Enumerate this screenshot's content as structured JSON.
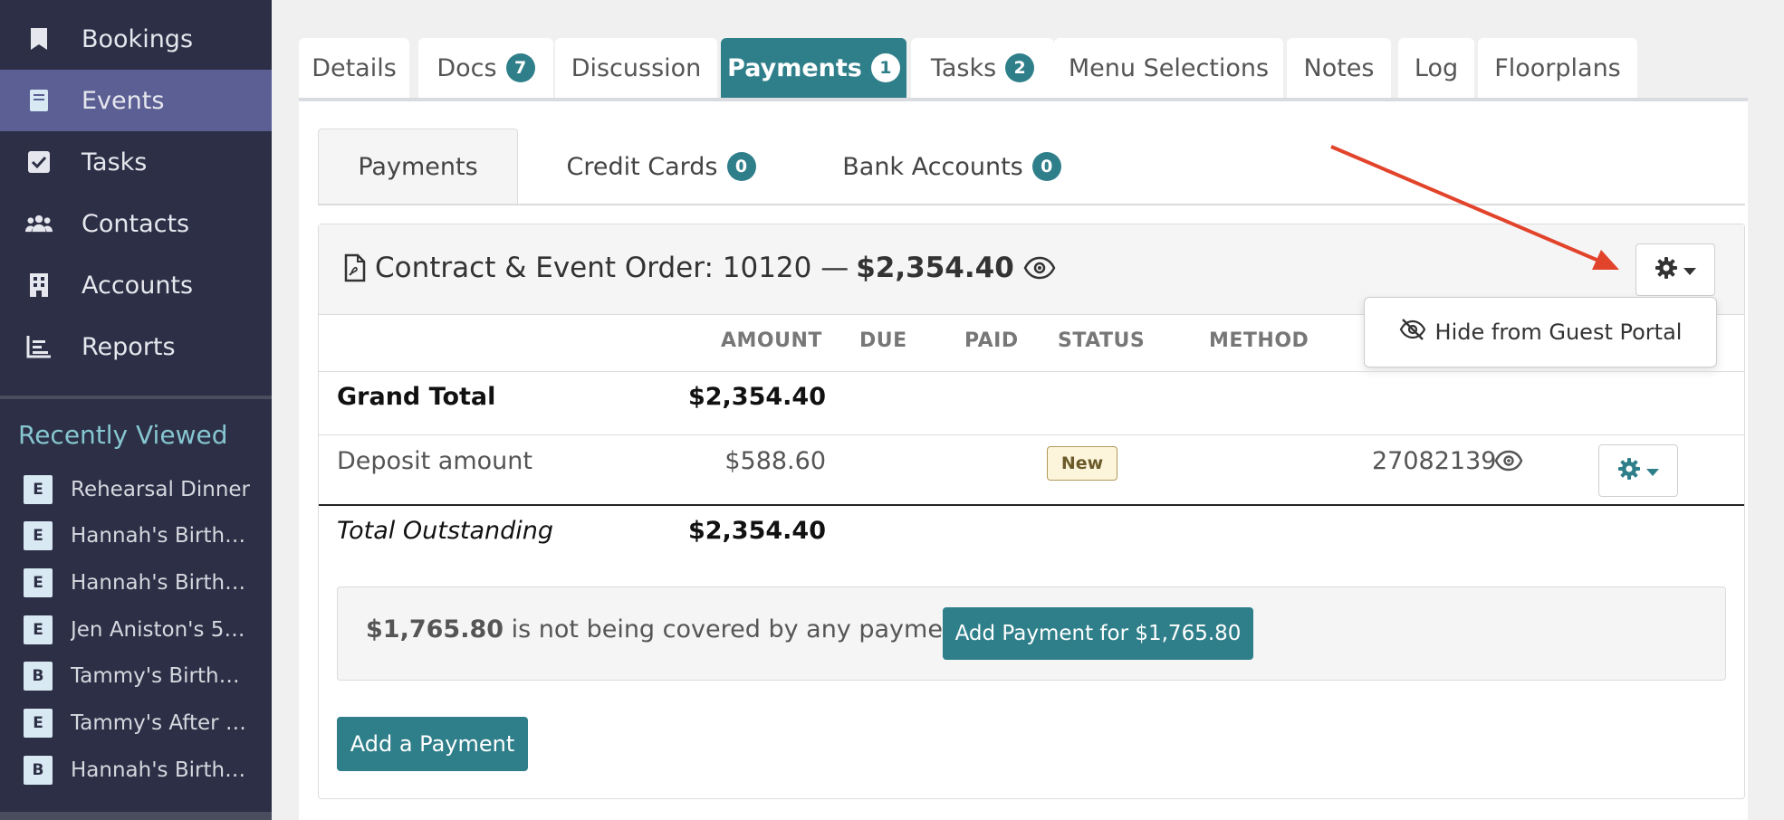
{
  "sidebar": {
    "nav": [
      {
        "label": "Bookings",
        "icon": "bookmark-icon"
      },
      {
        "label": "Events",
        "icon": "calendar-book-icon",
        "active": true
      },
      {
        "label": "Tasks",
        "icon": "checkbox-icon"
      },
      {
        "label": "Contacts",
        "icon": "users-icon"
      },
      {
        "label": "Accounts",
        "icon": "building-icon"
      },
      {
        "label": "Reports",
        "icon": "chart-icon"
      }
    ],
    "recently_viewed_title": "Recently Viewed",
    "recently_viewed": [
      {
        "badge": "E",
        "label": "Rehearsal Dinner"
      },
      {
        "badge": "E",
        "label": "Hannah's Birthd..."
      },
      {
        "badge": "E",
        "label": "Hannah's Birthd..."
      },
      {
        "badge": "E",
        "label": "Jen Aniston's 55..."
      },
      {
        "badge": "B",
        "label": "Tammy's Birthd..."
      },
      {
        "badge": "E",
        "label": "Tammy's After P..."
      },
      {
        "badge": "B",
        "label": "Hannah's Birthd..."
      }
    ]
  },
  "tabs": [
    {
      "label": "Details"
    },
    {
      "label": "Docs",
      "badge": "7"
    },
    {
      "label": "Discussion"
    },
    {
      "label": "Payments",
      "badge": "1",
      "active": true
    },
    {
      "label": "Tasks",
      "badge": "2"
    },
    {
      "label": "Menu Selections"
    },
    {
      "label": "Notes"
    },
    {
      "label": "Log"
    },
    {
      "label": "Floorplans"
    }
  ],
  "subtabs": [
    {
      "label": "Payments",
      "active": true
    },
    {
      "label": "Credit Cards",
      "badge": "0"
    },
    {
      "label": "Bank Accounts",
      "badge": "0"
    }
  ],
  "card": {
    "title": "Contract & Event Order: 10120 —",
    "title_amount": "$2,354.40",
    "dropdown_item": "Hide from Guest Portal",
    "columns": {
      "amount": "AMOUNT",
      "due": "DUE",
      "paid": "PAID",
      "status": "STATUS",
      "method": "METHOD"
    },
    "grand_total": {
      "label": "Grand Total",
      "amount": "$2,354.40"
    },
    "deposit": {
      "label": "Deposit amount",
      "amount": "$588.60",
      "status": "New",
      "reference": "27082139"
    },
    "total_outstanding": {
      "label": "Total Outstanding",
      "amount": "$2,354.40"
    },
    "notice": {
      "amount": "$1,765.80",
      "text": " is not being covered by any payments.",
      "button": "Add Payment for $1,765.80"
    },
    "add_payment_button": "Add a Payment"
  },
  "colors": {
    "accent": "#2f7f8a",
    "sidebar": "#2c2f45",
    "active_nav": "#5b5f94",
    "arrow": "#e2432b"
  }
}
